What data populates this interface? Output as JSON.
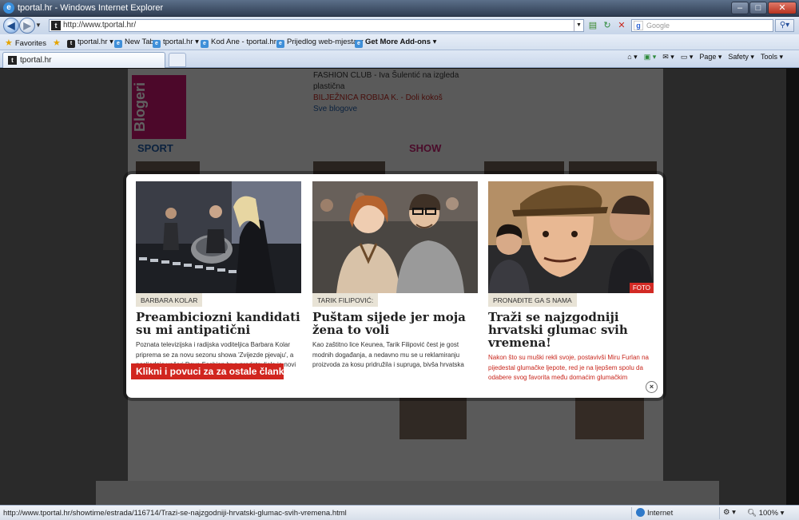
{
  "window": {
    "title": "tportal.hr - Windows Internet Explorer"
  },
  "navbar": {
    "address": "http://www.tportal.hr/",
    "search_placeholder": "Google"
  },
  "favorites_bar": {
    "favorites_label": "Favorites",
    "items": [
      {
        "label": "tportal.hr"
      },
      {
        "label": "New Tab"
      },
      {
        "label": "tportal.hr"
      },
      {
        "label": "Kod Ane - tportal.hr"
      },
      {
        "label": "Prijedlog web-mjesta"
      },
      {
        "label": "Get More Add-ons"
      }
    ]
  },
  "tabs": [
    {
      "label": "tportal.hr"
    }
  ],
  "command_bar": {
    "page": "Page",
    "safety": "Safety",
    "tools": "Tools"
  },
  "background_page": {
    "sections": [
      "SPORT",
      "SHOW"
    ],
    "lines_left": [
      "FASHION CLUB - Iva Šulentić na izgleda",
      "plastična",
      "BILJEŽNICA ROBIJA K. - Doli kokoš",
      "Sve blogove"
    ],
    "blogger_mark": "Blogeri"
  },
  "modal": {
    "cta_label": "Klikni i povuci za za ostale članke!",
    "close_symbol": "×",
    "cards": [
      {
        "tag": "BARBARA KOLAR",
        "headline": "Preambiciozni kandidati su mi antipatični",
        "body": "Poznata televizijska i radijska voditeljica Barbara Kolar priprema se za novu sezonu showa 'Zvijezde pjevaju', a posljednje večeri Dove Fashion.hr-a predstavljala je novi"
      },
      {
        "tag": "TARIK FILIPOVIĆ:",
        "headline": "Puštam sijede jer moja žena to voli",
        "body": "Kao zaštitno lice Keunea, Tarik Filipović čest je gost modnih događanja, a nedavno mu se u reklamiranju proizvoda za kosu pridružila i supruga, bivša hrvatska misica Lejla Šehović, koja je na Fashion.hr-u pokazala i novu frizuru"
      },
      {
        "tag": "PRONAĐITE GA S NAMA",
        "headline": "Traži se najzgodniji hrvatski glumac svih vremena!",
        "body": "Nakon što su muški rekli svoje, postavivši Miru Furlan na pijedestal glumačke ljepote, red je na ljepšem spolu da odabere svog favorita među domaćim glumačkim veličinama",
        "badge": "FOTO"
      }
    ]
  },
  "statusbar": {
    "url": "http://www.tportal.hr/showtime/estrada/116714/Trazi-se-najzgodniji-hrvatski-glumac-svih-vremena.html",
    "zone": "Internet",
    "zoom": "100%"
  }
}
